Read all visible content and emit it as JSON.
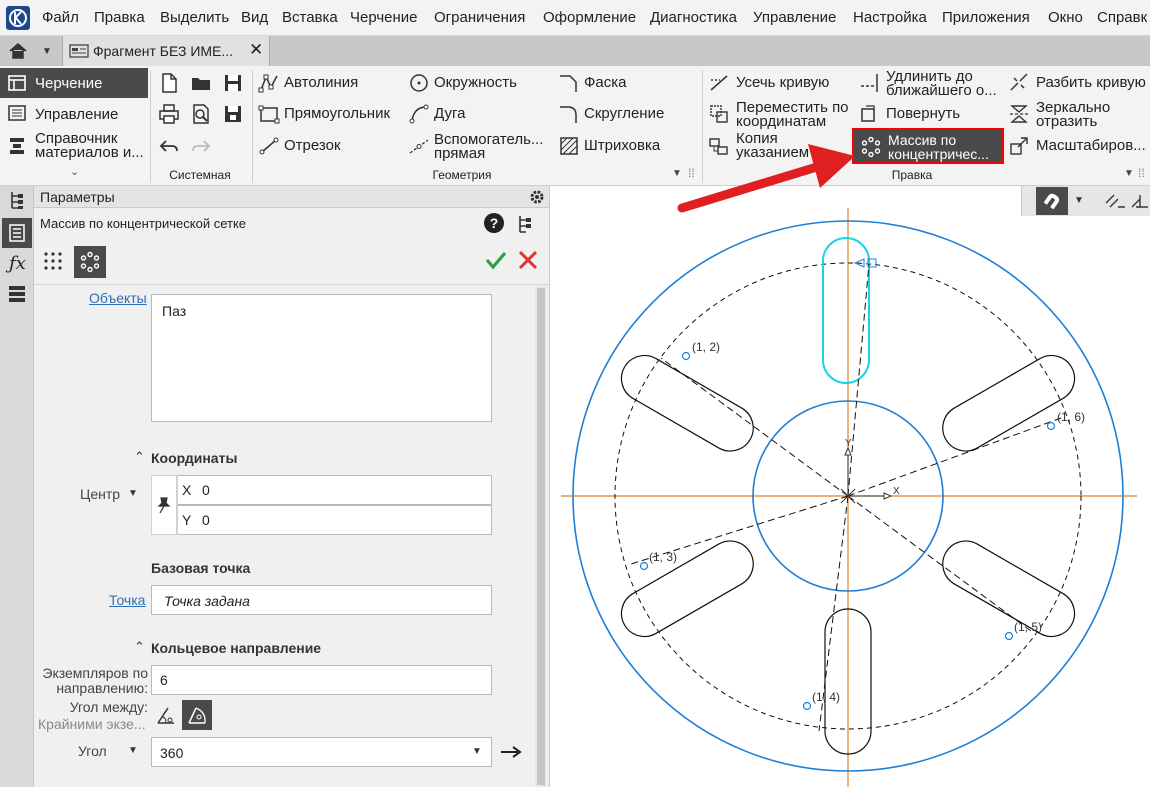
{
  "menu": [
    "Файл",
    "Правка",
    "Выделить",
    "Вид",
    "Вставка",
    "Черчение",
    "Ограничения",
    "Оформление",
    "Диагностика",
    "Управление",
    "Настройка",
    "Приложения",
    "Окно",
    "Справк"
  ],
  "doc_tab": {
    "title": "Фрагмент БЕЗ ИМЕ...",
    "close": "✕"
  },
  "sidebar": {
    "items": [
      {
        "label": "Черчение",
        "icon": "drafting-icon",
        "active": true
      },
      {
        "label": "Управление",
        "icon": "management-icon"
      },
      {
        "label": "Справочник материалов и...",
        "icon": "materials-icon"
      }
    ],
    "chevron": "»"
  },
  "ribbon": {
    "system_group": "Системная",
    "geometry_group": "Геометрия",
    "edit_group": "Правка",
    "geometry_tools": [
      {
        "label": "Автолиния",
        "icon": "autoline-icon"
      },
      {
        "label": "Прямоугольник",
        "icon": "rectangle-icon"
      },
      {
        "label": "Отрезок",
        "icon": "segment-icon"
      },
      {
        "label": "Окружность",
        "icon": "circle-icon"
      },
      {
        "label": "Дуга",
        "icon": "arc-icon"
      },
      {
        "label": "Вспомогатель... прямая",
        "icon": "aux-line-icon"
      },
      {
        "label": "Фаска",
        "icon": "chamfer-icon"
      },
      {
        "label": "Скругление",
        "icon": "fillet-icon"
      },
      {
        "label": "Штриховка",
        "icon": "hatch-icon"
      }
    ],
    "edit_tools": [
      {
        "label": "Усечь кривую",
        "icon": "trim-icon"
      },
      {
        "label": "Переместить по координатам",
        "icon": "move-coords-icon"
      },
      {
        "label": "Копия указанием",
        "icon": "copy-icon"
      },
      {
        "label": "Удлинить до ближайшего о...",
        "icon": "extend-icon"
      },
      {
        "label": "Повернуть",
        "icon": "rotate-icon"
      },
      {
        "label": "Массив по концентричес...",
        "icon": "circular-array-icon",
        "highlighted": true
      },
      {
        "label": "Разбить кривую",
        "icon": "split-icon"
      },
      {
        "label": "Зеркально отразить",
        "icon": "mirror-icon"
      },
      {
        "label": "Масштабиров...",
        "icon": "scale-icon"
      }
    ]
  },
  "params": {
    "panel_title": "Параметры",
    "command_title": "Массив по концентрической сетке",
    "objects_link": "Объекты",
    "objects_value": "Паз",
    "coords_header": "Координаты",
    "center_label": "Центр",
    "x_label": "X",
    "x_value": "0",
    "y_label": "Y",
    "y_value": "0",
    "base_point_header": "Базовая точка",
    "point_link": "Точка",
    "point_value": "Точка задана",
    "ring_header": "Кольцевое направление",
    "instances_label_1": "Экземпляров по",
    "instances_label_2": "направлению:",
    "instances_value": "6",
    "angle_between_label": "Угол между:",
    "angle_mode_label": "Крайними экзе...",
    "angle_label": "Угол",
    "angle_value": "360"
  },
  "canvas": {
    "labels": [
      "(1, 2)",
      "(1, 6)",
      "(1, 3)",
      "(1, 5)",
      "(1, 4)"
    ],
    "axis_x": "X",
    "axis_y": "Y",
    "highlight_color": "#ff0000",
    "arrow_color": "#e02020",
    "circle_color": "#1e7fd6",
    "selected_color": "#19d3e8",
    "axis_color": "#e0822a"
  }
}
